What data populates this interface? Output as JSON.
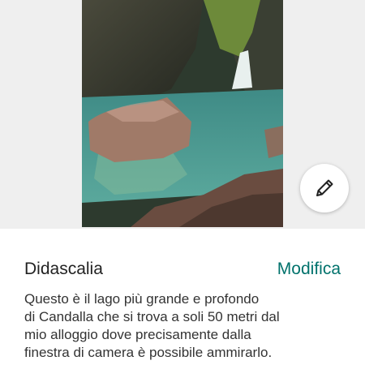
{
  "photo": {
    "alt": "waterfall-lake-photo"
  },
  "edit_photo_button": {
    "icon": "pencil-icon"
  },
  "caption": {
    "title": "Didascalia",
    "edit_label": "Modifica",
    "lines": [
      "Questo è il lago più grande e profondo",
      "di Candalla che si trova a soli 50 metri dal",
      "mio alloggio dove precisamente dalla",
      "finestra di camera è possibile ammirarlo."
    ]
  },
  "colors": {
    "accent": "#00726c",
    "text": "#222222",
    "background": "#ffffff"
  }
}
